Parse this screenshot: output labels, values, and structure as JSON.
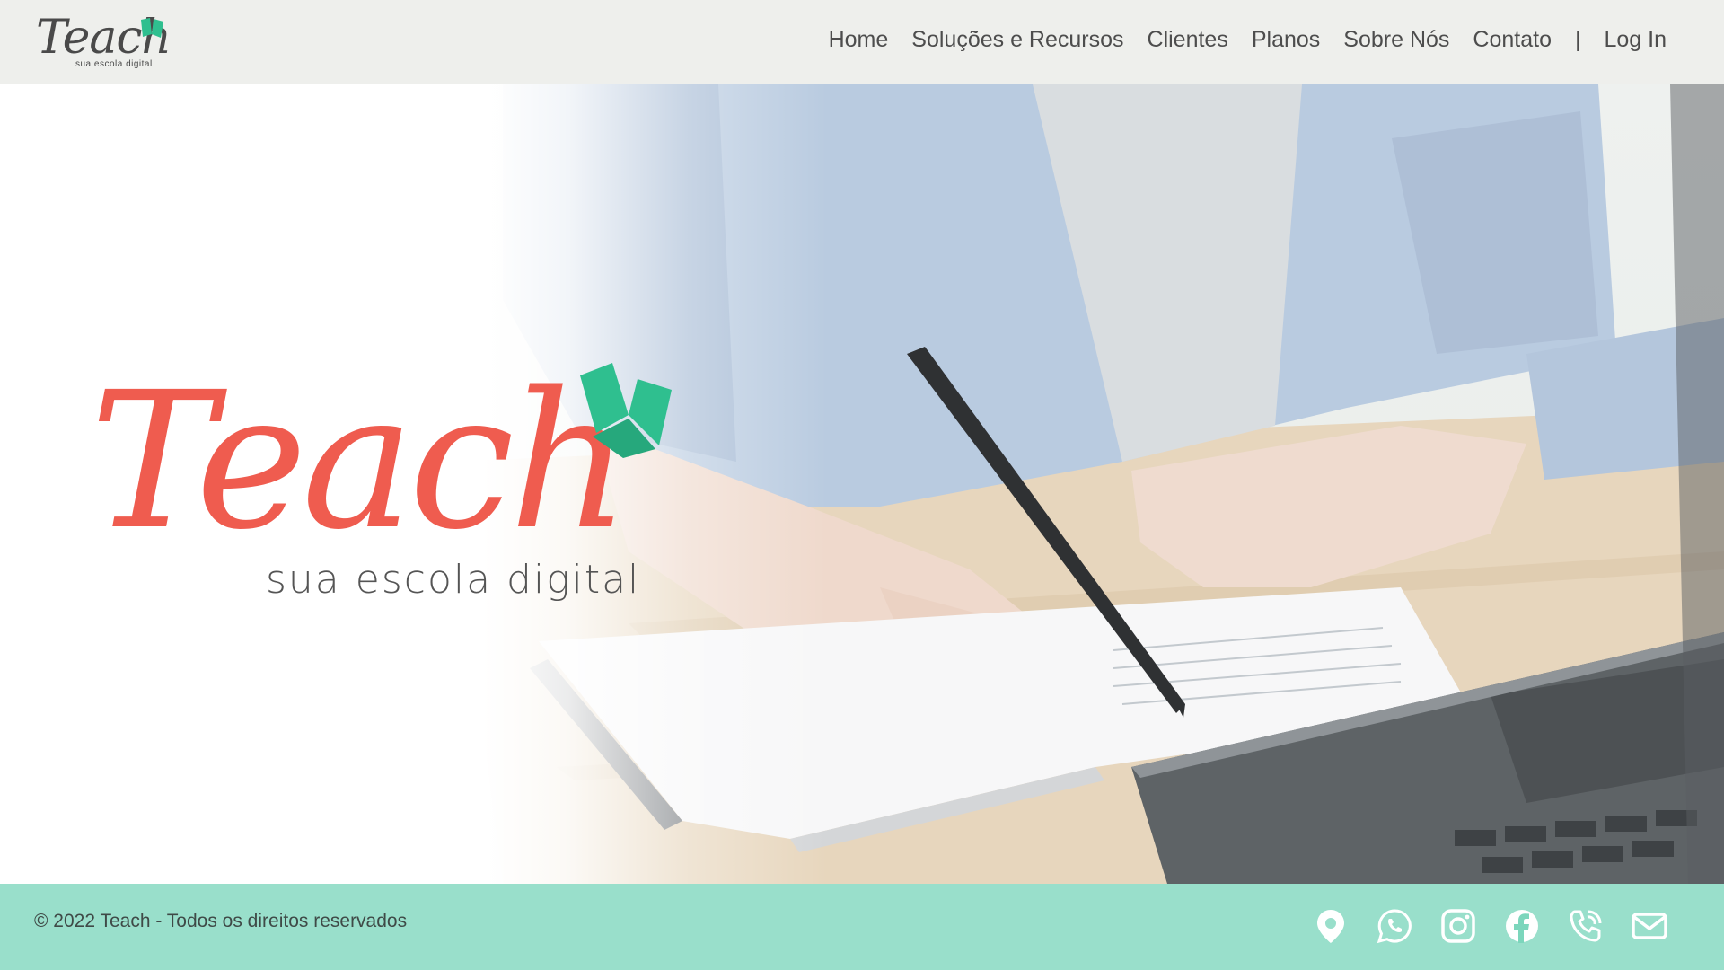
{
  "header": {
    "logo_text": "Teach",
    "logo_tagline": "sua escola digital",
    "nav": [
      {
        "label": "Home"
      },
      {
        "label": "Soluções e Recursos"
      },
      {
        "label": "Clientes"
      },
      {
        "label": "Planos"
      },
      {
        "label": "Sobre Nós"
      },
      {
        "label": "Contato"
      }
    ],
    "separator": "|",
    "login_label": "Log In"
  },
  "hero": {
    "logo_text": "Teach",
    "logo_tagline": "sua escola digital",
    "background_image": "person-writing-in-notebook-next-to-laptop"
  },
  "footer": {
    "copyright": "© 2022 Teach - Todos os direitos reservados",
    "social_icons": [
      "location-pin-icon",
      "whatsapp-icon",
      "instagram-icon",
      "facebook-icon",
      "phone-icon",
      "email-icon"
    ]
  },
  "colors": {
    "brand_coral": "#ef5c4f",
    "brand_green": "#2fbf8f",
    "header_bg": "#eeefec",
    "footer_bg": "#7cd6bc",
    "text_dark": "#4d4d4d"
  }
}
